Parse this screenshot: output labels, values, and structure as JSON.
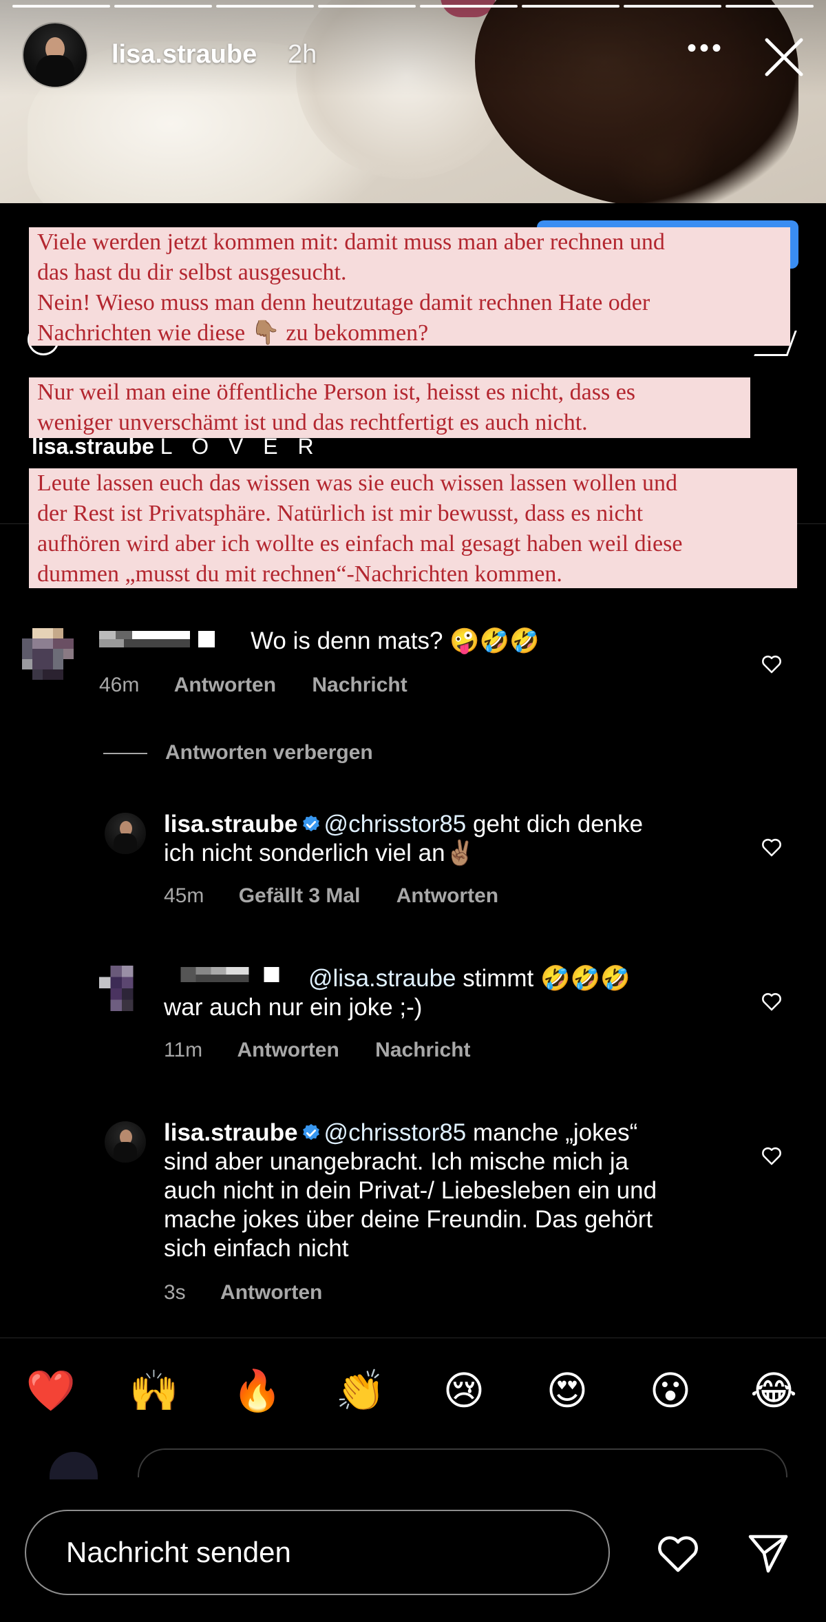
{
  "story": {
    "username": "lisa.straube",
    "time": "2h",
    "more_label": "•••"
  },
  "overlays": [
    "Viele werden jetzt kommen mit: damit muss man aber rechnen und\ndas hast du dir selbst ausgesucht.\nNein! Wieso muss man denn heutzutage damit rechnen Hate oder\nNachrichten wie diese 👇🏽 zu bekommen?",
    "Nur weil man eine öffentliche Person ist, heisst es nicht, dass es\nweniger unverschämt ist und das rechtfertigt es auch nicht.",
    "Leute lassen euch das wissen was sie euch wissen lassen wollen und\nder Rest ist Privatsphäre. Natürlich ist mir bewusst, dass es nicht\naufhören wird aber ich wollte es einfach mal gesagt haben weil diese\ndummen „musst du mit rechnen“-Nachrichten kommen."
  ],
  "caption": {
    "username": "lisa.straube",
    "text": "L O V E R"
  },
  "comments": [
    {
      "text": "Wo is denn mats? 🤪🤣🤣",
      "time": "46m",
      "reply": "Antworten",
      "message": "Nachricht"
    },
    {
      "user": "lisa.straube",
      "mention": "@chrisstor85",
      "text_line1": " geht dich denke",
      "text_line2": "ich nicht sonderlich viel an✌🏽",
      "time": "45m",
      "likes": "Gefällt 3 Mal",
      "reply": "Antworten"
    },
    {
      "mention": "@lisa.straube",
      "text_line1": " stimmt 🤣🤣🤣",
      "text_line2": "war auch nur ein joke ;-)",
      "time": "11m",
      "reply": "Antworten",
      "message": "Nachricht"
    },
    {
      "user": "lisa.straube",
      "mention": "@chrisstor85",
      "text_line1": " manche „jokes“",
      "text_rest": [
        "sind aber unangebracht. Ich mische mich ja",
        "auch nicht in dein Privat-/ Liebesleben ein und",
        "mache jokes über deine Freundin. Das gehört",
        "sich einfach nicht"
      ],
      "time": "3s",
      "reply": "Antworten"
    }
  ],
  "hide_replies": "Antworten verbergen",
  "reactions": [
    "❤️",
    "🙌",
    "🔥",
    "👏",
    "😢",
    "😍",
    "😮",
    "😂"
  ],
  "footer": {
    "placeholder": "Nachricht senden"
  },
  "colors": {
    "overlay_bg": "#f6dcdc",
    "overlay_text": "#b3262f",
    "meta_gray": "#a8a8a8",
    "verified_blue": "#3897f0"
  }
}
